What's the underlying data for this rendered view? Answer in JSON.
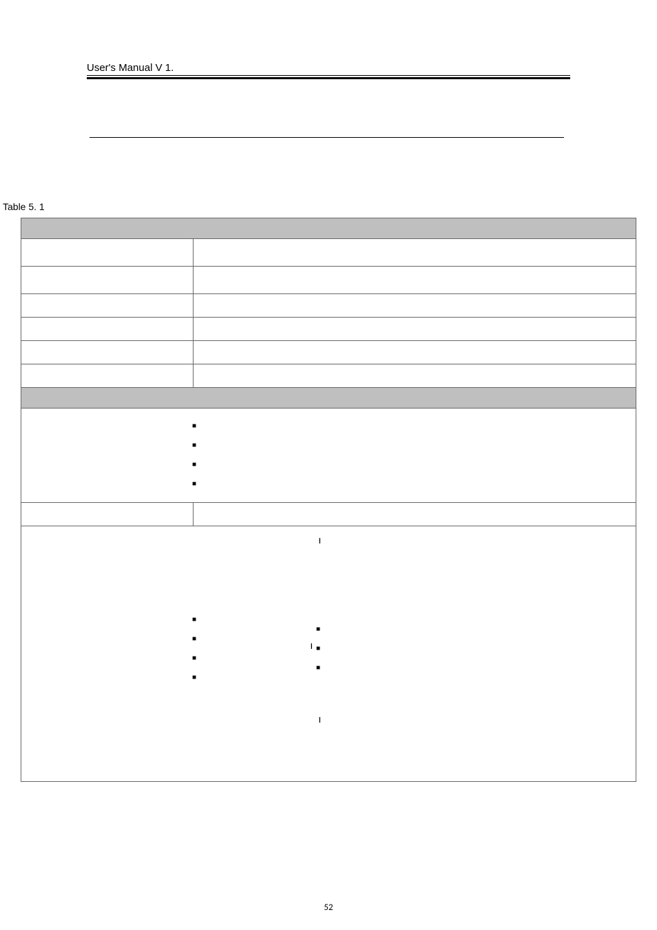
{
  "header": {
    "title": "User's Manual V 1."
  },
  "caption": "Table 5. 1",
  "bullets": {
    "square": "■",
    "tick": "❙"
  },
  "page_number": "52"
}
